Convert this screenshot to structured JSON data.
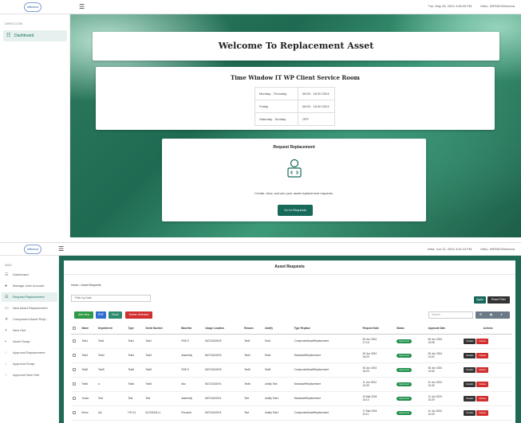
{
  "brand": {
    "logo_text": "infineon"
  },
  "shot1": {
    "topbar": {
      "datetime": "Tue, May 28, 2024 4:28:00 PM",
      "greeting": "Hello, INFINEON\\unnna"
    },
    "sidebar": {
      "caption": "DIRECCIÓN",
      "items": [
        {
          "label": "Dashboard",
          "icon": "grid-icon"
        }
      ]
    },
    "welcome_title": "Welcome To Replacement Asset",
    "time_window": {
      "title": "Time Window IT WP Client Service Room",
      "rows": [
        {
          "day": "Monday - Thursday",
          "time": "08:00 - 16:30 2024"
        },
        {
          "day": "Friday",
          "time": "08:00 - 16:30 2024"
        },
        {
          "day": "Saturday - Sunday",
          "time": "OFF"
        }
      ]
    },
    "request": {
      "title": "Request Replacement",
      "text": "Create, view, and see your asset replacement requests.",
      "button": "Go to Requests"
    }
  },
  "shot2": {
    "topbar": {
      "datetime": "Wed, Jun 12, 2024 3:31:10 PM",
      "greeting": "Hello, INFINEON\\unnna"
    },
    "sidebar": {
      "caption": "MAIN",
      "items": [
        {
          "label": "Dashboard",
          "icon": "grid-icon"
        },
        {
          "label": "Manage User Account",
          "icon": "user-icon"
        },
        {
          "label": "Request Replacement",
          "icon": "list-icon"
        },
        {
          "label": "New Asset Replacement",
          "icon": "doc-icon"
        },
        {
          "label": "Component Asset Repl...",
          "icon": "x-icon"
        },
        {
          "label": "New Hire",
          "icon": "person-plus-icon"
        },
        {
          "label": "Asset Scrap",
          "icon": "box-icon"
        },
        {
          "label": "Approval Replacement",
          "icon": "check-circle-icon"
        },
        {
          "label": "Approval Scrap",
          "icon": "check-circle-icon"
        },
        {
          "label": "Approval New Hire",
          "icon": "check-circle-icon"
        }
      ]
    },
    "title": "Asset Requests",
    "breadcrumb": {
      "home": "Home",
      "sep": ">",
      "current": "Asset Requests"
    },
    "filter_placeholder": "Filter by Date",
    "apply": "Apply",
    "reset": "Reset Filter",
    "actions": {
      "add": "Add New",
      "pdf": "PDF",
      "excel": "Excel",
      "delete": "Delete Selected"
    },
    "search_placeholder": "Search",
    "view_toggle": [
      "☰",
      "▦",
      "▾"
    ],
    "columns": [
      "",
      "Name",
      "Department",
      "Type",
      "Serial Number",
      "Baseline",
      "Usage Location",
      "Reason",
      "Justify",
      "Type Replace",
      "Request Date",
      "Status",
      "Approval Date",
      "Actions"
    ],
    "rows": [
      {
        "name": "Test1",
        "dept": "Test1",
        "type": "Test1",
        "serial": "Test1",
        "baseline": "FMS 5",
        "location": "BAT10U3OH3",
        "reason": "Test1",
        "justify": "Test1",
        "replace": "ComponentAssetReplacement",
        "req_date": "06 Jun 2024",
        "req_time": "17:16",
        "status": "Approved",
        "app_date": "06 Jun 2024",
        "app_time": "13:08"
      },
      {
        "name": "Test4",
        "dept": "Test4",
        "type": "Test4",
        "serial": "Test4",
        "baseline": "Assembly",
        "location": "BAT10U3OH3",
        "reason": "Test4",
        "justify": "Test4",
        "replace": "NewAssetReplacement",
        "req_date": "05 Jun 2024",
        "req_time": "16:29",
        "status": "Approved",
        "app_date": "05 Jun 2024",
        "app_time": "14:02"
      },
      {
        "name": "Test5",
        "dept": "Test5",
        "type": "Test5",
        "serial": "Test5",
        "baseline": "FMS 5",
        "location": "BAT10U3OH3",
        "reason": "Test5",
        "justify": "Test5",
        "replace": "ComponentAssetReplacement",
        "req_date": "06 Jun 2024",
        "req_time": "16:29",
        "status": "Approved",
        "app_date": "06 Jun 2024",
        "app_time": "14:05"
      },
      {
        "name": "Test6",
        "dept": "a",
        "type": "Test6",
        "serial": "Test6",
        "baseline": "Aku",
        "location": "BAT10U3OH1",
        "reason": "Test6",
        "justify": "Justify Test",
        "replace": "NewAssetReplacement",
        "req_date": "11 Jun 2024",
        "req_time": "10:09",
        "status": "Approved",
        "app_date": "11 Jun 2024",
        "app_time": "10:49"
      },
      {
        "name": "Yuuko",
        "dept": "Test",
        "type": "Test",
        "serial": "Test",
        "baseline": "Assembly",
        "location": "BAT10U3OH1",
        "reason": "Test",
        "justify": "Justify Test1",
        "replace": "NewAssetReplacement",
        "req_date": "10 Mar 2024",
        "req_time": "10:10",
        "status": "Approved",
        "app_date": "11 Jun 2024",
        "app_time": "10:29"
      },
      {
        "name": "Kirino",
        "dept": "QA",
        "type": "HP-C4",
        "serial": "5CG3194LL1",
        "baseline": "Personal",
        "location": "BAT10U3OH1",
        "reason": "Test",
        "justify": "Justify Test1",
        "replace": "ComponentAssetReplacement",
        "req_date": "17 Mar 2024",
        "req_time": "10:11",
        "status": "Approved",
        "app_date": "11 Jun 2024",
        "app_time": "10:29"
      }
    ],
    "row_actions": {
      "details": "Details",
      "delete": "Delete"
    }
  }
}
